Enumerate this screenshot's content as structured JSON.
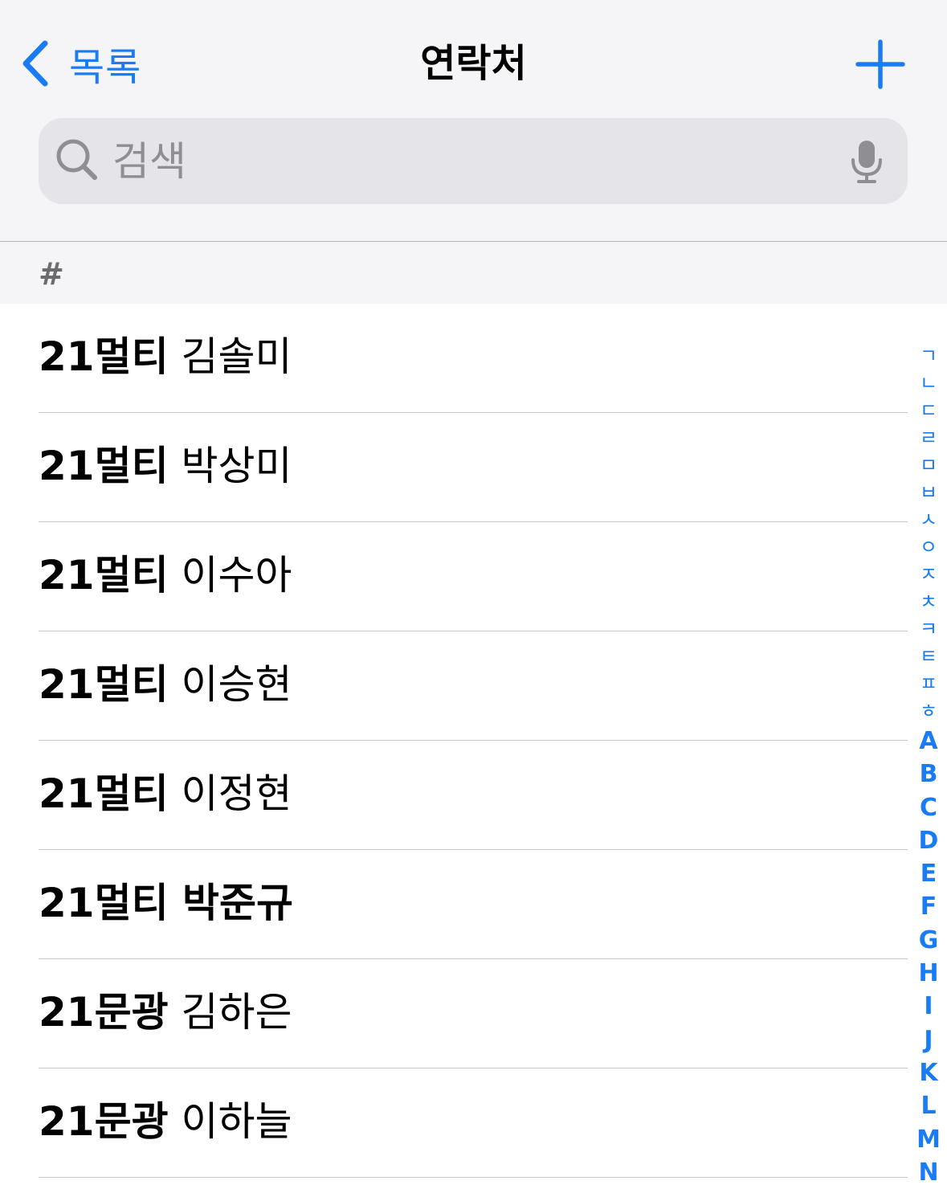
{
  "nav": {
    "back_label": "목록",
    "title": "연락처",
    "add_icon": "plus-icon"
  },
  "search": {
    "placeholder": "검색",
    "value": ""
  },
  "section": {
    "label": "#"
  },
  "contacts": [
    {
      "prefix": "21멀티",
      "name": "김솔미",
      "bold_name": false
    },
    {
      "prefix": "21멀티",
      "name": "박상미",
      "bold_name": false
    },
    {
      "prefix": "21멀티",
      "name": "이수아",
      "bold_name": false
    },
    {
      "prefix": "21멀티",
      "name": "이승현",
      "bold_name": false
    },
    {
      "prefix": "21멀티",
      "name": "이정현",
      "bold_name": false
    },
    {
      "prefix": "21멀티",
      "name": "박준규",
      "bold_name": true
    },
    {
      "prefix": "21문광",
      "name": "김하은",
      "bold_name": false
    },
    {
      "prefix": "21문광",
      "name": "이하늘",
      "bold_name": false
    }
  ],
  "index": {
    "korean": [
      "ㄱ",
      "ㄴ",
      "ㄷ",
      "ㄹ",
      "ㅁ",
      "ㅂ",
      "ㅅ",
      "ㅇ",
      "ㅈ",
      "ㅊ",
      "ㅋ",
      "ㅌ",
      "ㅍ",
      "ㅎ"
    ],
    "latin": [
      "A",
      "B",
      "C",
      "D",
      "E",
      "F",
      "G",
      "H",
      "I",
      "J",
      "K",
      "L",
      "M",
      "N"
    ]
  },
  "colors": {
    "accent": "#1a7cf5",
    "header_bg": "#f5f5f7",
    "search_bg": "#e4e4e9"
  }
}
